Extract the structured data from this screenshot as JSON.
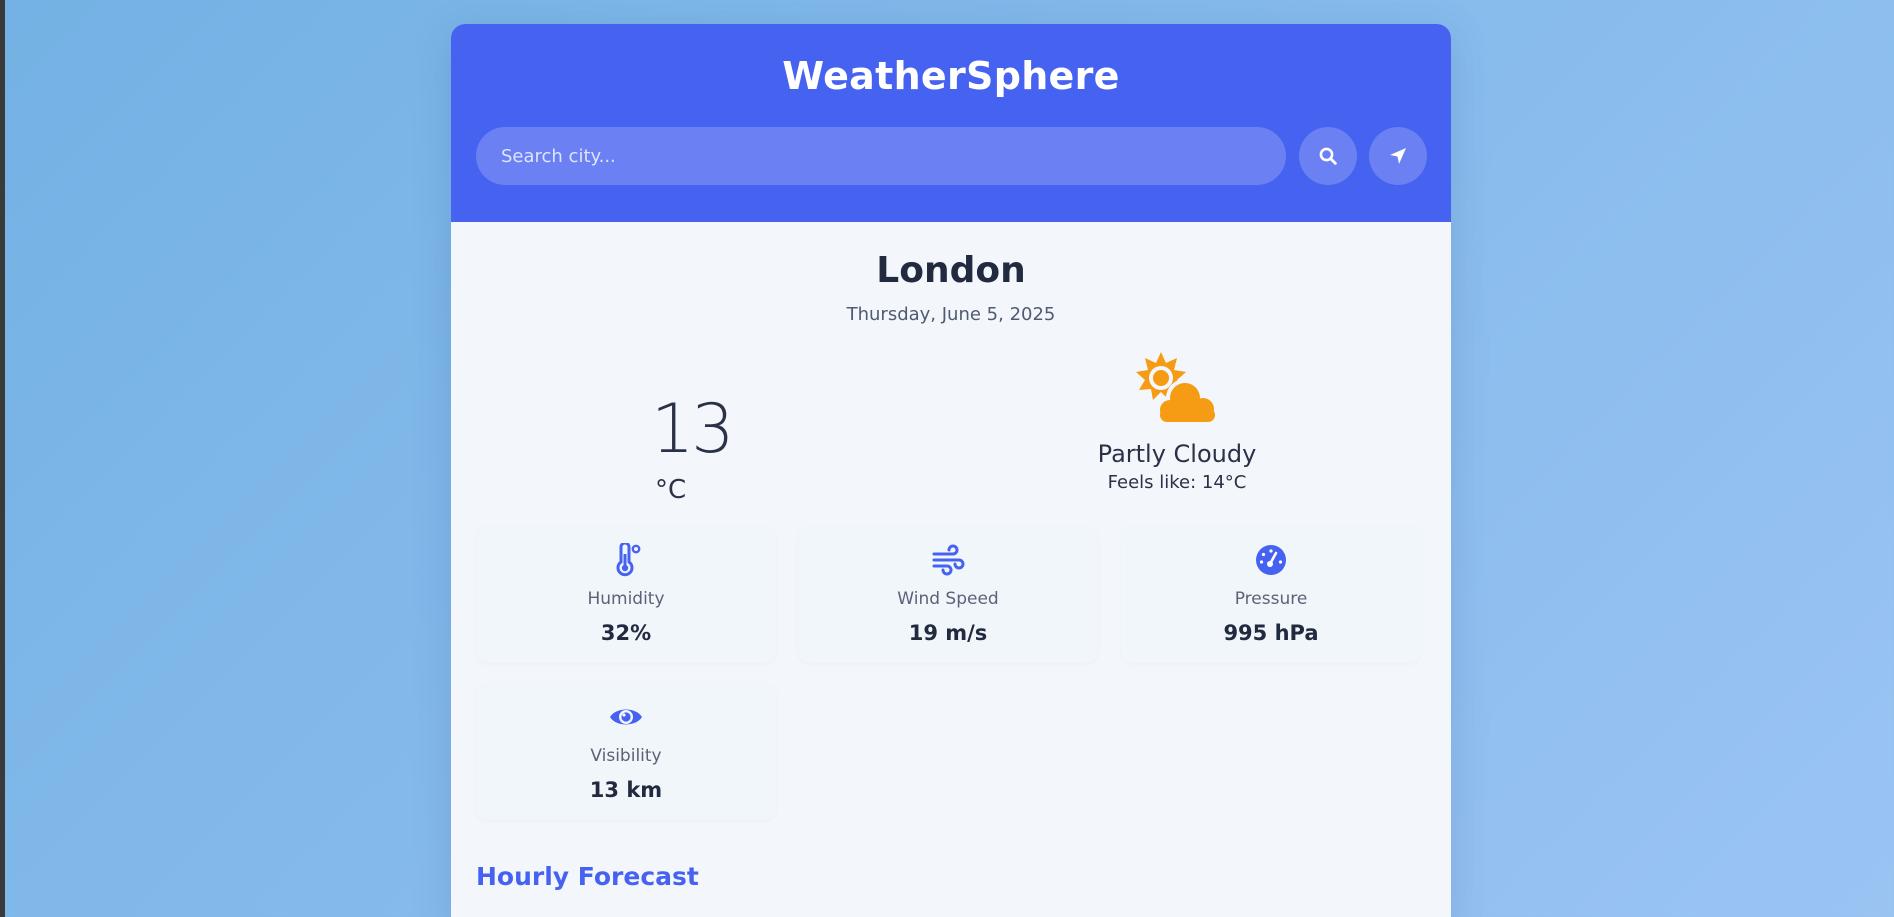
{
  "app": {
    "title": "WeatherSphere"
  },
  "search": {
    "placeholder": "Search city..."
  },
  "current": {
    "city": "London",
    "date": "Thursday, June 5, 2025",
    "temperature": "13",
    "unit": "°C",
    "condition": "Partly Cloudy",
    "feels_like": "Feels like: 14°C",
    "condition_icon": "partly-cloudy-icon"
  },
  "stats": [
    {
      "label": "Humidity",
      "value": "32%",
      "icon": "thermometer-icon"
    },
    {
      "label": "Wind Speed",
      "value": "19 m/s",
      "icon": "wind-icon"
    },
    {
      "label": "Pressure",
      "value": "995 hPa",
      "icon": "gauge-icon"
    },
    {
      "label": "Visibility",
      "value": "13 km",
      "icon": "eye-icon"
    }
  ],
  "hourly": {
    "title": "Hourly Forecast"
  },
  "colors": {
    "header": "#4662f0",
    "accent": "#4662f0",
    "sun": "#f59b14",
    "card_bg": "#f3f7fc"
  }
}
